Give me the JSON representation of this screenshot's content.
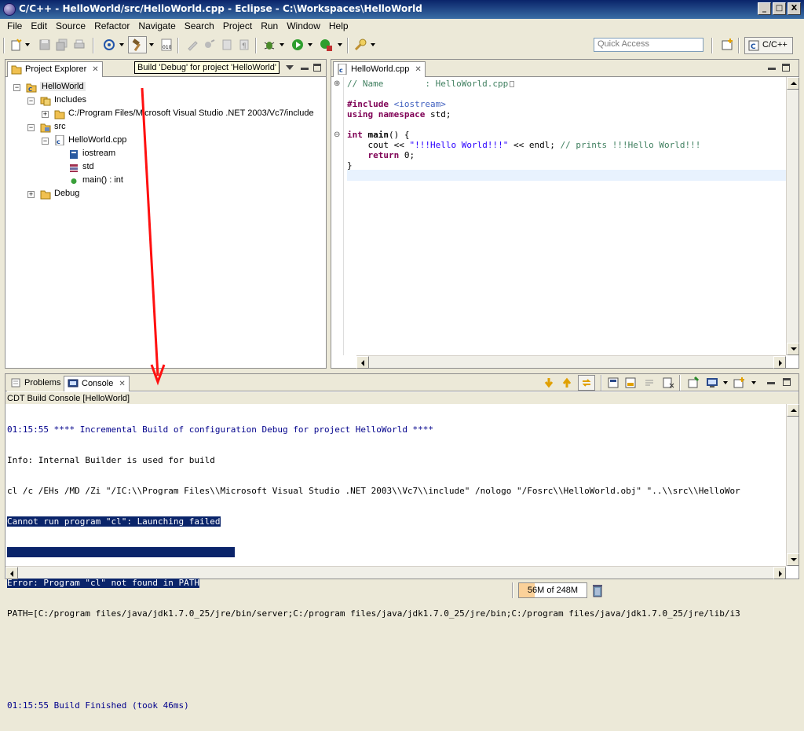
{
  "window": {
    "title": "C/C++ - HelloWorld/src/HelloWorld.cpp - Eclipse - C:\\Workspaces\\HelloWorld",
    "buttons": {
      "minimize": "_",
      "maximize": "□",
      "close": "X"
    }
  },
  "menu": [
    {
      "label": "File"
    },
    {
      "label": "Edit"
    },
    {
      "label": "Source"
    },
    {
      "label": "Refactor"
    },
    {
      "label": "Navigate"
    },
    {
      "label": "Search"
    },
    {
      "label": "Project"
    },
    {
      "label": "Run"
    },
    {
      "label": "Window"
    },
    {
      "label": "Help"
    }
  ],
  "toolbar": {
    "quick_access_placeholder": "Quick Access",
    "perspective_label": "C/C++"
  },
  "tooltip": "Build 'Debug' for project 'HelloWorld'",
  "project_explorer": {
    "tab_label": "Project Explorer",
    "tree": [
      {
        "label": "HelloWorld",
        "icon": "project-icon"
      },
      {
        "label": "Includes",
        "icon": "includes-icon"
      },
      {
        "label": "C:/Program Files/Microsoft Visual Studio .NET 2003/Vc7/include",
        "icon": "include-folder-icon"
      },
      {
        "label": "src",
        "icon": "source-folder-icon"
      },
      {
        "label": "HelloWorld.cpp",
        "icon": "cpp-file-icon"
      },
      {
        "label": "iostream",
        "icon": "include-icon"
      },
      {
        "label": "std",
        "icon": "namespace-icon"
      },
      {
        "label": "main() : int",
        "icon": "function-icon"
      },
      {
        "label": "Debug",
        "icon": "folder-icon"
      }
    ]
  },
  "editor": {
    "tab_label": "HelloWorld.cpp",
    "lines": {
      "l1": "// Name        : HelloWorld.cpp",
      "l2_kw": "#include",
      "l2_inc": "<iostream>",
      "l3_kw1": "using",
      "l3_kw2": "namespace",
      "l3_rest": "std;",
      "l4_kw": "int",
      "l4_fn": "main",
      "l4_rest": "() {",
      "l5_a": "cout << ",
      "l5_str": "\"!!!Hello World!!!\"",
      "l5_b": " << endl; ",
      "l5_cm": "// prints !!!Hello World!!!",
      "l6_kw": "return",
      "l6_rest": " 0;",
      "l7": "}"
    }
  },
  "bottom_panel": {
    "tabs": [
      {
        "label": "Problems"
      },
      {
        "label": "Console"
      }
    ],
    "console_title": "CDT Build Console [HelloWorld]",
    "console_lines": [
      "01:15:55 **** Incremental Build of configuration Debug for project HelloWorld ****",
      "Info: Internal Builder is used for build",
      "cl /c /EHs /MD /Zi \"/IC:\\\\Program Files\\\\Microsoft Visual Studio .NET 2003\\\\Vc7\\\\include\" /nologo \"/Fosrc\\\\HelloWorld.obj\" \"..\\\\src\\\\HelloWor",
      "Cannot run program \"cl\": Launching failed",
      "",
      "Error: Program \"cl\" not found in PATH",
      "PATH=[C:/program files/java/jdk1.7.0_25/jre/bin/server;C:/program files/java/jdk1.7.0_25/jre/bin;C:/program files/java/jdk1.7.0_25/jre/lib/i3",
      "",
      "",
      "01:15:55 Build Finished (took 46ms)"
    ]
  },
  "status": {
    "heap_text": "56M of 248M",
    "heap_used_fraction": 0.23
  }
}
